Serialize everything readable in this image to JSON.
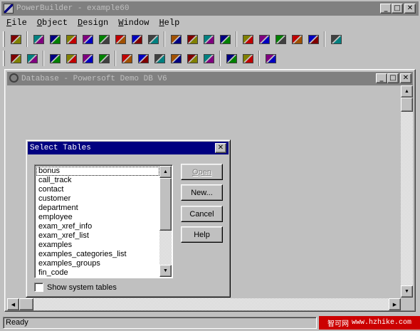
{
  "app": {
    "title": "PowerBuilder - example60",
    "min_glyph": "_",
    "max_glyph": "□",
    "close_glyph": "✕"
  },
  "menu": [
    {
      "label": "File",
      "key": "F",
      "rest": "ile"
    },
    {
      "label": "Object",
      "key": "O",
      "rest": "bject"
    },
    {
      "label": "Design",
      "key": "D",
      "rest": "esign"
    },
    {
      "label": "Window",
      "key": "W",
      "rest": "indow"
    },
    {
      "label": "Help",
      "key": "H",
      "rest": "elp"
    }
  ],
  "toolbar1": [
    "painter-dropdown-icon",
    "application-icon",
    "window-painter-icon",
    "menu-painter-icon",
    "datawindow-icon",
    "structure-icon",
    "function-icon",
    "library-icon",
    "user-object-icon",
    "query-icon",
    "database-icon",
    "pipeline-icon",
    "data-manager-icon",
    "project-icon",
    "preferences-icon",
    "run-icon",
    "debug-icon",
    "browser-icon",
    "exit-icon"
  ],
  "toolbar2": [
    "tables-icon",
    "table-list-icon",
    "key-icon",
    "index-icon",
    "view-icon",
    "filter-icon",
    "edit-icon",
    "eraser-icon",
    "log-icon",
    "extended-attr-icon",
    "connect-icon",
    "properties-icon",
    "layout-icon",
    "script-icon",
    "return-icon"
  ],
  "db_window": {
    "title": "Database - Powersoft Demo DB V6"
  },
  "dialog": {
    "title": "Select Tables",
    "tables": [
      "bonus",
      "call_track",
      "contact",
      "customer",
      "department",
      "employee",
      "exam_xref_info",
      "exam_xref_list",
      "examples",
      "examples_categories_list",
      "examples_groups",
      "fin_code"
    ],
    "selected_index": 0,
    "buttons": {
      "open": "Open",
      "new": "New...",
      "cancel": "Cancel",
      "help": "Help"
    },
    "show_system_tables": "Show system tables"
  },
  "status": {
    "text": "Ready"
  },
  "watermark": {
    "cn": "智可网",
    "site": "www.hzhike.com"
  },
  "colors": {
    "face": "#c0c0c0",
    "active_title": "#000080",
    "inactive_title": "#808080",
    "watermark": "#cc0000"
  }
}
